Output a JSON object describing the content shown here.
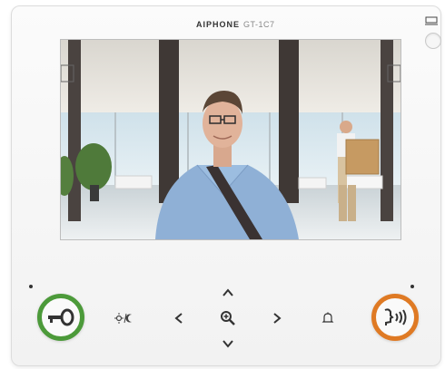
{
  "brand": {
    "name": "AIPHONE",
    "model": "GT-1C7"
  },
  "buttons": {
    "door_release": {
      "icon": "key-icon",
      "ring_color": "#4c9a3a"
    },
    "talk": {
      "icon": "talk-icon",
      "ring_color": "#df7a24"
    }
  },
  "controls": [
    {
      "name": "brightness-night-button",
      "icon": "sun-moon-icon"
    },
    {
      "name": "left-arrow-button",
      "icon": "chevron-left-icon"
    },
    {
      "name": "up-arrow-button",
      "icon": "chevron-up-icon"
    },
    {
      "name": "zoom-button",
      "icon": "magnifier-icon"
    },
    {
      "name": "down-arrow-button",
      "icon": "chevron-down-icon"
    },
    {
      "name": "right-arrow-button",
      "icon": "chevron-right-icon"
    },
    {
      "name": "chime-button",
      "icon": "bell-icon"
    }
  ],
  "indicators": {
    "monitor_icon": "monitor-icon",
    "power_button": "power-button"
  },
  "video": {
    "scene": "camera-feed"
  }
}
